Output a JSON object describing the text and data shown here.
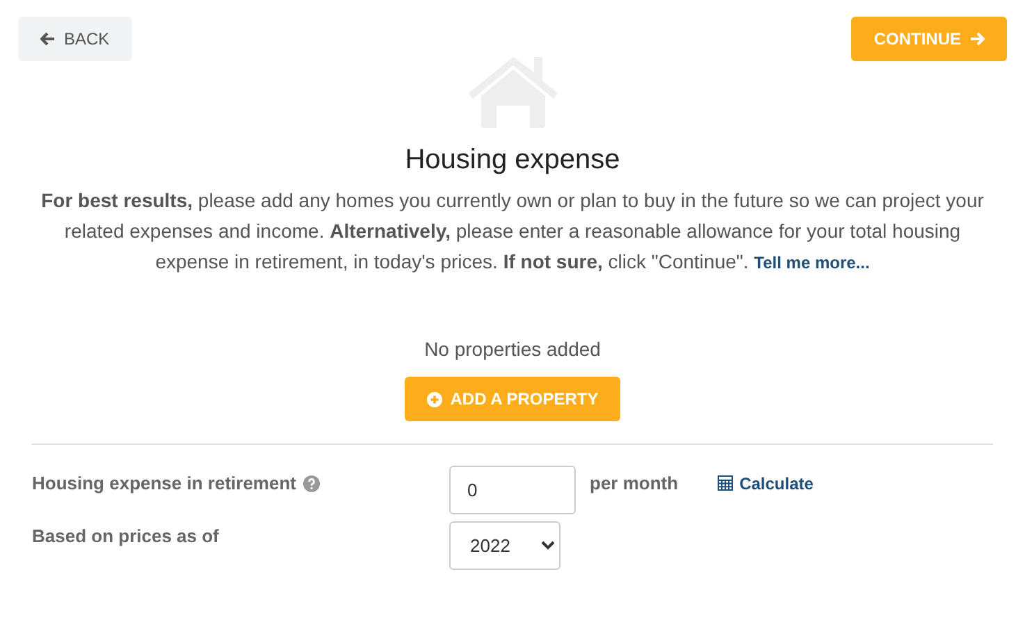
{
  "back_button": {
    "label": "BACK"
  },
  "continue_button": {
    "label": "CONTINUE"
  },
  "title": "Housing expense",
  "description": {
    "text": "**For best results,** please add any homes you currently own or plan to buy in the future so we can project your related expenses and income. **Alternatively,** please enter a reasonable allowance for your total housing expense in retirement, in today's prices. **If not sure,** click \"Continue\".",
    "link": "Tell me more..."
  },
  "empty_message": "No properties added",
  "add_button": {
    "label": "ADD A PROPERTY"
  },
  "expense_field": {
    "label": "Housing expense in retirement",
    "value": "0",
    "unit": "per month",
    "action": "Calculate"
  },
  "year_field": {
    "label": "Based on prices as of",
    "value": "2022"
  }
}
